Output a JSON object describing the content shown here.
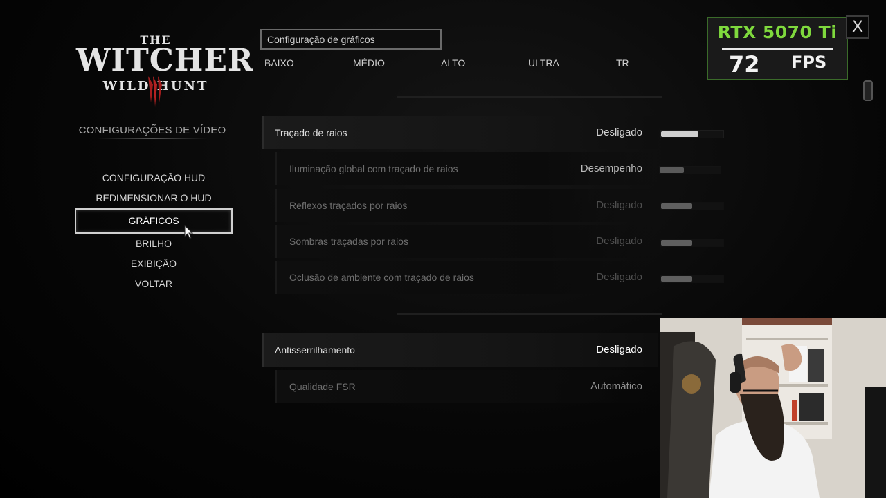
{
  "game": {
    "logo_the": "THE",
    "logo_main": "WITCHER",
    "logo_sub": "WILD   HUNT",
    "section_title": "CONFIGURAÇÕES DE VÍDEO"
  },
  "menu": {
    "items": [
      {
        "label": "CONFIGURAÇÃO HUD"
      },
      {
        "label": "REDIMENSIONAR O HUD"
      },
      {
        "label": "GRÁFICOS"
      },
      {
        "label": "BRILHO"
      },
      {
        "label": "EXIBIÇÃO"
      },
      {
        "label": "VOLTAR"
      }
    ],
    "selected": "GRÁFICOS"
  },
  "preset": {
    "label": "Configuração de gráficos",
    "options": [
      "BAIXO",
      "MÉDIO",
      "ALTO",
      "ULTRA",
      "TR"
    ]
  },
  "settings": {
    "ray_tracing": {
      "label": "Traçado de raios",
      "value": "Desligado",
      "level": 0.6
    },
    "rt_gi": {
      "label": "Iluminação global com traçado de raios",
      "value": "Desempenho",
      "level": 0.4
    },
    "rt_reflections": {
      "label": "Reflexos traçados por raios",
      "value": "Desligado",
      "level": 0.5
    },
    "rt_shadows": {
      "label": "Sombras traçadas por raios",
      "value": "Desligado",
      "level": 0.5
    },
    "rt_ao": {
      "label": "Oclusão de ambiente com traçado de raios",
      "value": "Desligado",
      "level": 0.5
    },
    "antialiasing": {
      "label": "Antisserrilhamento",
      "value": "Desligado"
    },
    "fsr_quality": {
      "label": "Qualidade FSR",
      "value": "Automático"
    }
  },
  "overlay": {
    "gpu": "RTX 5070 Ti",
    "fps": "72",
    "fps_unit": "FPS",
    "close": "X"
  },
  "colors": {
    "overlay_green": "#7fd93d",
    "menu_highlight": "#d0d0d0"
  },
  "icons": {
    "close": "close-icon",
    "cursor": "mouse-cursor-icon",
    "emblem": "wolf-claw-emblem-icon"
  }
}
